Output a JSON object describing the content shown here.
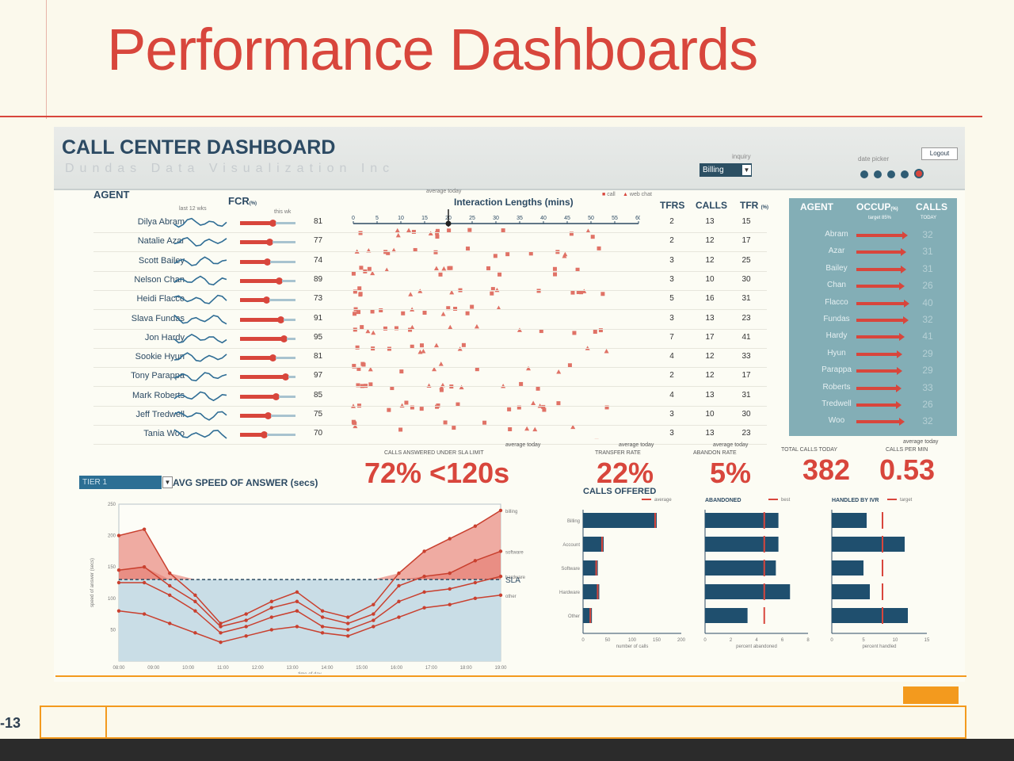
{
  "slide": {
    "title": "Performance Dashboards",
    "page": "-13"
  },
  "dashboard": {
    "title": "CALL CENTER DASHBOARD",
    "subtitle": "Dundas Data Visualization Inc",
    "inquiry_label": "inquiry",
    "inquiry_value": "Billing",
    "date_picker_label": "date picker",
    "logout_label": "Logout"
  },
  "agents_table": {
    "agent_header": "AGENT",
    "fcr_header": "FCR",
    "fcr_unit": "(%)",
    "last12_label": "last 12 wks",
    "this_wk_label": "this wk",
    "interaction_title": "Interaction Lengths (mins)",
    "avg_today_label": "average today",
    "legend_call": "call",
    "legend_webchat": "web chat",
    "axis_ticks": [
      "0",
      "5",
      "10",
      "15",
      "20",
      "25",
      "30",
      "35",
      "40",
      "45",
      "50",
      "55",
      "60"
    ],
    "tfrs_header": "TFRS",
    "calls_header": "CALLS",
    "tfr_header": "TFR",
    "tfr_unit": "(%)",
    "rows": [
      {
        "name": "Dilya Abram",
        "fcr": 81,
        "tfrs": 2,
        "calls": 13,
        "tfr": 15
      },
      {
        "name": "Natalie Azar",
        "fcr": 77,
        "tfrs": 2,
        "calls": 12,
        "tfr": 17
      },
      {
        "name": "Scott Bailey",
        "fcr": 74,
        "tfrs": 3,
        "calls": 12,
        "tfr": 25
      },
      {
        "name": "Nelson Chan",
        "fcr": 89,
        "tfrs": 3,
        "calls": 10,
        "tfr": 30
      },
      {
        "name": "Heidi Flacco",
        "fcr": 73,
        "tfrs": 5,
        "calls": 16,
        "tfr": 31
      },
      {
        "name": "Slava Fundas",
        "fcr": 91,
        "tfrs": 3,
        "calls": 13,
        "tfr": 23
      },
      {
        "name": "Jon Hardy",
        "fcr": 95,
        "tfrs": 7,
        "calls": 17,
        "tfr": 41
      },
      {
        "name": "Sookie Hyun",
        "fcr": 81,
        "tfrs": 4,
        "calls": 12,
        "tfr": 33
      },
      {
        "name": "Tony Parappa",
        "fcr": 97,
        "tfrs": 2,
        "calls": 12,
        "tfr": 17
      },
      {
        "name": "Mark Roberts",
        "fcr": 85,
        "tfrs": 4,
        "calls": 13,
        "tfr": 31
      },
      {
        "name": "Jeff Tredwell",
        "fcr": 75,
        "tfrs": 3,
        "calls": 10,
        "tfr": 30
      },
      {
        "name": "Tania Woo",
        "fcr": 70,
        "tfrs": 3,
        "calls": 13,
        "tfr": 23
      }
    ]
  },
  "occupancy": {
    "agent_header": "AGENT",
    "occup_header": "OCCUP",
    "occup_unit": "(%)",
    "occup_target": "target 85%",
    "calls_header": "CALLS",
    "calls_sub": "TODAY",
    "rows": [
      {
        "name": "Abram",
        "occup": 0.9,
        "calls": 32
      },
      {
        "name": "Azar",
        "occup": 0.88,
        "calls": 31
      },
      {
        "name": "Bailey",
        "occup": 0.88,
        "calls": 31
      },
      {
        "name": "Chan",
        "occup": 0.85,
        "calls": 26
      },
      {
        "name": "Flacco",
        "occup": 0.93,
        "calls": 40
      },
      {
        "name": "Fundas",
        "occup": 0.92,
        "calls": 32
      },
      {
        "name": "Hardy",
        "occup": 0.85,
        "calls": 41
      },
      {
        "name": "Hyun",
        "occup": 0.8,
        "calls": 29
      },
      {
        "name": "Parappa",
        "occup": 0.8,
        "calls": 29
      },
      {
        "name": "Roberts",
        "occup": 0.78,
        "calls": 33
      },
      {
        "name": "Tredwell",
        "occup": 0.78,
        "calls": 26
      },
      {
        "name": "Woo",
        "occup": 0.85,
        "calls": 32
      }
    ]
  },
  "kpis": {
    "avg_today": "average today",
    "sla_label": "CALLS ANSWERED UNDER SLA LIMIT",
    "sla_value": "72% <120s",
    "transfer_label": "TRANSFER RATE",
    "transfer_value": "22%",
    "abandon_label": "ABANDON RATE",
    "abandon_value": "5%",
    "total_label": "TOTAL CALLS TODAY",
    "total_value": "382",
    "cpm_label": "CALLS PER MIN",
    "cpm_value": "0.53"
  },
  "asa": {
    "tier_value": "TIER 1",
    "title": "AVG SPEED OF ANSWER (secs)",
    "ylabel": "speed of answer (secs)",
    "xlabel": "time of day",
    "sla_label": "SLA",
    "series_labels": [
      "billing",
      "software",
      "hardware",
      "other"
    ]
  },
  "chart_data": [
    {
      "type": "line",
      "title": "AVG SPEED OF ANSWER (secs)",
      "xlabel": "time of day",
      "ylabel": "speed of answer (secs)",
      "categories": [
        "08:00",
        "09:00",
        "10:00",
        "11:00",
        "12:00",
        "13:00",
        "14:00",
        "15:00",
        "16:00",
        "17:00",
        "18:00",
        "19:00"
      ],
      "ylim": [
        0,
        250
      ],
      "yticks": [
        50,
        100,
        150,
        200,
        250
      ],
      "sla": 130,
      "series": [
        {
          "name": "billing",
          "values": [
            200,
            210,
            140,
            105,
            60,
            75,
            95,
            110,
            80,
            70,
            90,
            140,
            175,
            195,
            215,
            240
          ]
        },
        {
          "name": "software",
          "values": [
            145,
            150,
            120,
            95,
            55,
            65,
            85,
            95,
            70,
            60,
            75,
            120,
            135,
            140,
            160,
            175
          ]
        },
        {
          "name": "hardware",
          "values": [
            125,
            125,
            105,
            80,
            45,
            55,
            70,
            80,
            55,
            50,
            65,
            95,
            110,
            115,
            125,
            135
          ]
        },
        {
          "name": "other",
          "values": [
            80,
            75,
            60,
            45,
            30,
            40,
            50,
            55,
            45,
            40,
            55,
            70,
            85,
            90,
            100,
            105
          ]
        }
      ]
    },
    {
      "type": "bar",
      "title": "CALLS OFFERED",
      "xlabel": "number of calls",
      "legend": "average",
      "categories": [
        "Billing",
        "Account",
        "Software",
        "Hardware",
        "Other"
      ],
      "values": [
        150,
        42,
        30,
        33,
        18
      ],
      "xlim": [
        0,
        200
      ],
      "xticks": [
        0,
        50,
        100,
        150,
        200
      ]
    },
    {
      "type": "bar",
      "title": "ABANDONED",
      "xlabel": "percent abandoned",
      "legend": "best",
      "categories": [
        "Billing",
        "Account",
        "Software",
        "Hardware",
        "Other"
      ],
      "values": [
        5.7,
        5.7,
        5.5,
        6.6,
        3.3
      ],
      "best": [
        4.6,
        4.6,
        4.6,
        4.6,
        4.6
      ],
      "xlim": [
        0,
        8
      ],
      "xticks": [
        0,
        2,
        4,
        6,
        8
      ]
    },
    {
      "type": "bar",
      "title": "HANDLED BY IVR",
      "xlabel": "percent handled",
      "legend": "target",
      "categories": [
        "Billing",
        "Account",
        "Software",
        "Hardware",
        "Other"
      ],
      "values": [
        5.5,
        11.5,
        5,
        6,
        12
      ],
      "target": [
        8,
        8,
        8,
        8,
        8
      ],
      "xlim": [
        0,
        15
      ],
      "xticks": [
        0,
        5,
        10,
        15
      ]
    }
  ]
}
